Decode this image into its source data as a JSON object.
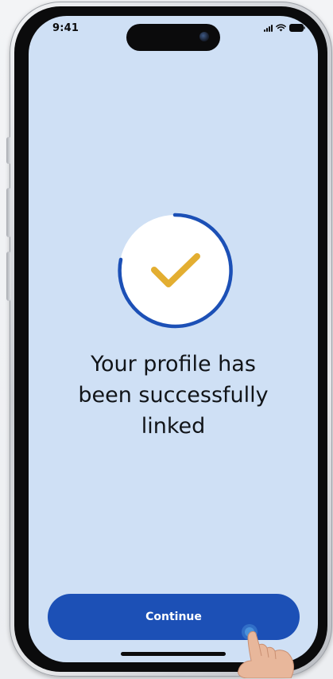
{
  "status_bar": {
    "time": "9:41",
    "icons": [
      "signal-icon",
      "wifi-icon",
      "battery-icon"
    ]
  },
  "content": {
    "icon": "check-icon",
    "message": "Your profile has\nbeen successfully\nlinked"
  },
  "actions": {
    "continue_label": "Continue"
  },
  "colors": {
    "screen_background": "#cfe0f5",
    "primary": "#1c50b6",
    "check": "#e3ae31",
    "ring": "#1c50b6"
  }
}
